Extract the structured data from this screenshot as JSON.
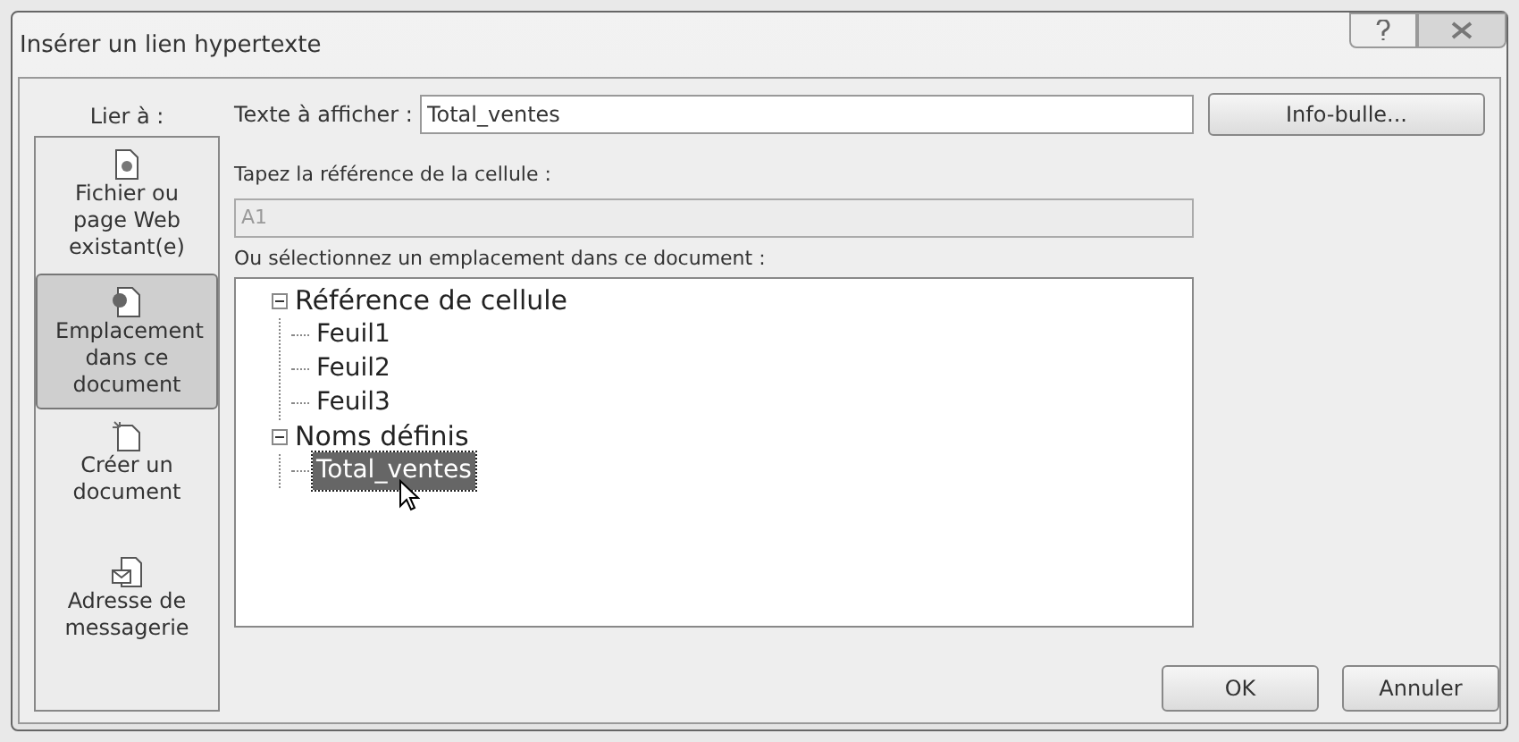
{
  "window": {
    "title": "Insérer un lien hypertexte"
  },
  "link_to": {
    "label": "Lier à :",
    "items": [
      {
        "kind": "file",
        "label": "Fichier ou page Web existant(e)",
        "selected": false
      },
      {
        "kind": "place",
        "label": "Emplacement dans ce document",
        "selected": true
      },
      {
        "kind": "new",
        "label": "Créer un document",
        "selected": false
      },
      {
        "kind": "mail",
        "label": "Adresse de messagerie",
        "selected": false
      }
    ]
  },
  "display_text": {
    "label": "Texte à afficher :",
    "value": "Total_ventes"
  },
  "cell_ref": {
    "label": "Tapez la référence de la cellule :",
    "value": "A1",
    "disabled": true
  },
  "place": {
    "label": "Ou sélectionnez un emplacement dans ce document :",
    "tree": [
      {
        "label": "Référence de cellule",
        "expanded": true,
        "selected": false,
        "children": [
          {
            "label": "Feuil1",
            "selected": false
          },
          {
            "label": "Feuil2",
            "selected": false
          },
          {
            "label": "Feuil3",
            "selected": false
          }
        ]
      },
      {
        "label": "Noms définis",
        "expanded": true,
        "selected": false,
        "children": [
          {
            "label": "Total_ventes",
            "selected": true
          }
        ]
      }
    ]
  },
  "buttons": {
    "tooltip": "Info-bulle...",
    "ok": "OK",
    "cancel": "Annuler"
  }
}
